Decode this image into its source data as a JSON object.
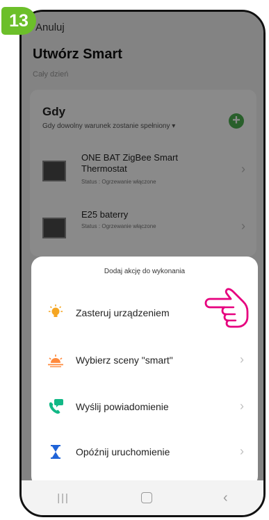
{
  "step": {
    "number": "13",
    "color": "#6cbf2a"
  },
  "header": {
    "cancel": "Anuluj",
    "title": "Utwórz Smart",
    "subtitle": "Cały dzień"
  },
  "condition": {
    "title": "Gdy",
    "description": "Gdy dowolny warunek zostanie spełniony",
    "description_arrow": "▾",
    "add_icon": "plus-circle-icon",
    "devices": [
      {
        "name": "ONE BAT ZigBee Smart Thermostat",
        "status": "Status : Ogrzewanie włączone"
      },
      {
        "name": "E25 baterry",
        "status": "Status : Ogrzewanie włączone"
      }
    ]
  },
  "sheet": {
    "title": "Dodaj akcję do wykonania",
    "items": [
      {
        "label": "Zasteruj urządzeniem",
        "icon": "bulb-icon",
        "chevron": "›"
      },
      {
        "label": "Wybierz sceny \"smart\"",
        "icon": "sunrise-icon",
        "chevron": "›"
      },
      {
        "label": "Wyślij powiadomienie",
        "icon": "phone-message-icon",
        "chevron": "›"
      },
      {
        "label": "Opóźnij uruchomienie",
        "icon": "hourglass-icon",
        "chevron": "›"
      }
    ]
  },
  "navbar": {
    "recent": "|||",
    "back": "‹"
  },
  "colors": {
    "accent_green": "#4caf50",
    "pointer_pink": "#e6007e",
    "timer_blue": "#1f63d8",
    "bulb_orange": "#f5a623"
  }
}
